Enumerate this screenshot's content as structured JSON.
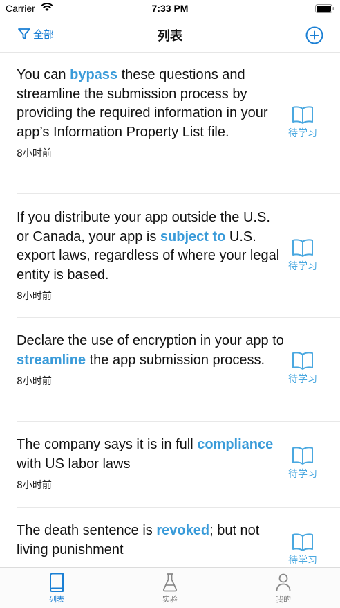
{
  "status_bar": {
    "carrier": "Carrier",
    "time": "7:33 PM"
  },
  "nav": {
    "filter_label": "全部",
    "title": "列表"
  },
  "items": [
    {
      "before": "You can ",
      "highlight": "bypass",
      "after": " these questions and streamline the submission process by providing the required information in your app’s Information Property List file.",
      "time": "8小时前",
      "status": "待学习"
    },
    {
      "before": "If you distribute your app outside the U.S. or Canada, your app is ",
      "highlight": "subject to",
      "after": " U.S. export laws, regardless of where your legal entity is based.",
      "time": "8小时前",
      "status": "待学习"
    },
    {
      "before": "Declare the use of encryption in your app to ",
      "highlight": "streamline",
      "after": " the app submission process.",
      "time": "8小时前",
      "status": "待学习"
    },
    {
      "before": "The company says it is in full ",
      "highlight": "compliance",
      "after": " with US labor laws",
      "time": "8小时前",
      "status": "待学习"
    },
    {
      "before": "The death sentence is ",
      "highlight": "revoked",
      "after": "; but not living punishment",
      "time": "",
      "status": "待学习"
    }
  ],
  "tabs": [
    {
      "label": "列表",
      "icon": "book-icon",
      "active": true
    },
    {
      "label": "实验",
      "icon": "flask-icon",
      "active": false
    },
    {
      "label": "我的",
      "icon": "person-icon",
      "active": false
    }
  ],
  "colors": {
    "accent": "#1a7fd4",
    "highlight": "#3a9bd9",
    "status": "#4aa8e0"
  }
}
